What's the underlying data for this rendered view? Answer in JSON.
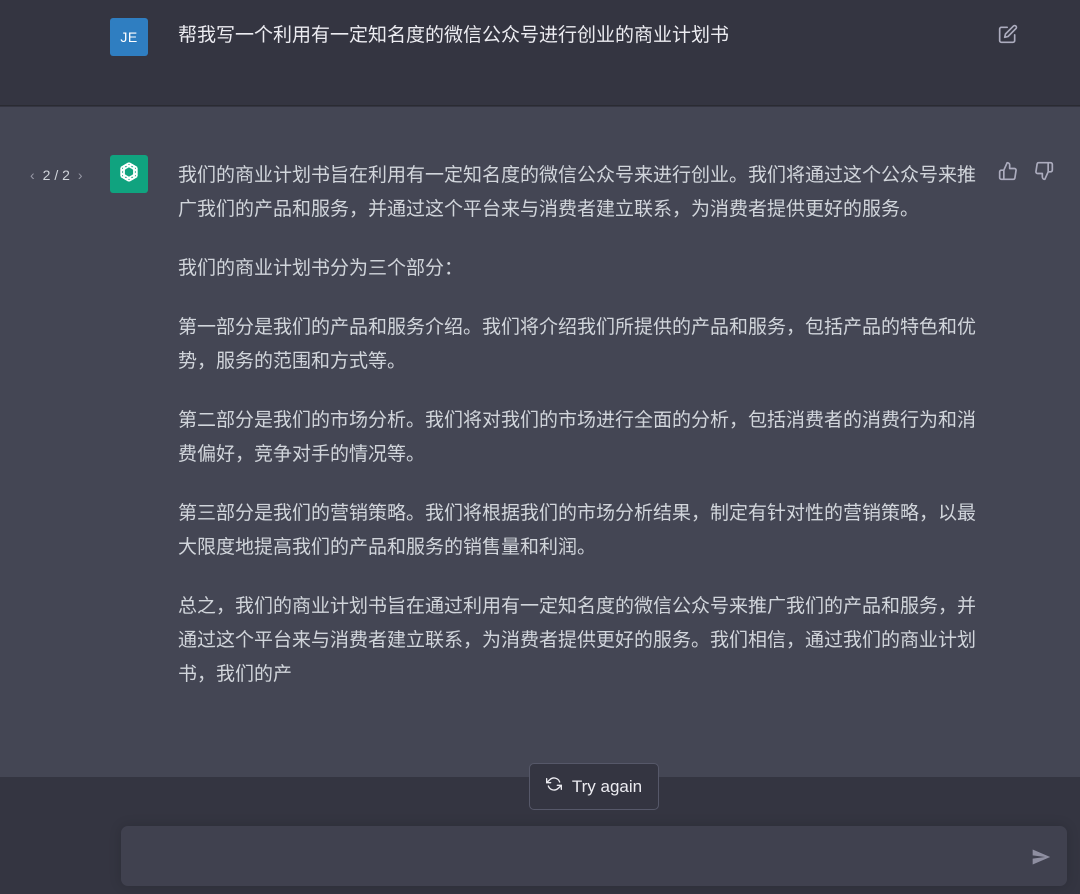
{
  "user_message": {
    "avatar_initials": "JE",
    "avatar_color": "#2f7ec1",
    "text": "帮我写一个利用有一定知名度的微信公众号进行创业的商业计划书",
    "edit_icon": "edit-icon"
  },
  "assistant_message": {
    "pager": {
      "prev_icon": "chevron-left-icon",
      "label": "2 / 2",
      "next_icon": "chevron-right-icon"
    },
    "avatar_icon": "openai-logo-icon",
    "avatar_color": "#10a37f",
    "paragraphs": [
      "我们的商业计划书旨在利用有一定知名度的微信公众号来进行创业。我们将通过这个公众号来推广我们的产品和服务，并通过这个平台来与消费者建立联系，为消费者提供更好的服务。",
      "我们的商业计划书分为三个部分：",
      "第一部分是我们的产品和服务介绍。我们将介绍我们所提供的产品和服务，包括产品的特色和优势，服务的范围和方式等。",
      "第二部分是我们的市场分析。我们将对我们的市场进行全面的分析，包括消费者的消费行为和消费偏好，竞争对手的情况等。",
      "第三部分是我们的营销策略。我们将根据我们的市场分析结果，制定有针对性的营销策略，以最大限度地提高我们的产品和服务的销售量和利润。",
      "总之，我们的商业计划书旨在通过利用有一定知名度的微信公众号来推广我们的产品和服务，并通过这个平台来与消费者建立联系，为消费者提供更好的服务。我们相信，通过我们的商业计划书，我们的产"
    ],
    "feedback_icons": [
      "thumbs-up-icon",
      "thumbs-down-icon"
    ]
  },
  "controls": {
    "try_again_label": "Try again",
    "try_again_icon": "refresh-icon",
    "input_placeholder": "",
    "send_icon": "send-icon"
  },
  "colors": {
    "background": "#343541",
    "assistant_background": "#444654",
    "input_background": "#40414f"
  }
}
